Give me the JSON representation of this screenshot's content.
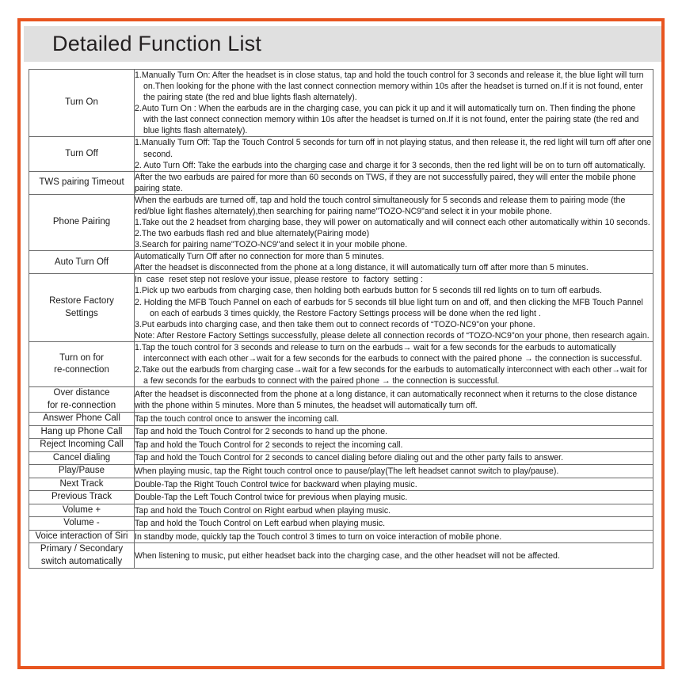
{
  "theme": {
    "frame_color": "#e8551f",
    "title_band_color": "#e0e0e0",
    "table_border_color": "#6b6b6b",
    "text_color": "#1a1a1a"
  },
  "header": {
    "title": "Detailed Function List"
  },
  "table": {
    "rows": [
      {
        "name": "Turn On",
        "lines": [
          {
            "style": "num",
            "text": "1.Manually Turn On: After the headset is in close status, tap and hold the touch control for 3 seconds and release it, the blue light will turn on.Then looking for the phone with the last connect connection memory within 10s after the headset is turned on.If it is not found, enter the pairing state (the red and blue lights flash alternately)."
          },
          {
            "style": "num",
            "text": "2.Auto Turn On : When the earbuds are in the charging case, you can pick it up and it will automatically turn on. Then finding the phone with the last connect connection memory within 10s after the headset is turned on.If it is not found, enter the pairing state (the red and blue lights flash alternately)."
          }
        ]
      },
      {
        "name": "Turn Off",
        "lines": [
          {
            "style": "num",
            "text": "1.Manually Turn Off: Tap the Touch Control 5 seconds for turn off in not playing status, and then release it, the red light will turn off after one second."
          },
          {
            "style": "num",
            "text": "2. Auto Turn Off: Take the earbuds into the charging case and charge it for 3 seconds, then the red light will be on to turn off automatically."
          }
        ]
      },
      {
        "name": "TWS pairing Timeout",
        "lines": [
          {
            "style": "plain",
            "text": "After the two earbuds are paired for more than 60 seconds on TWS, if they are not successfully paired, they will enter the mobile phone pairing state."
          }
        ]
      },
      {
        "name": "Phone Pairing",
        "lines": [
          {
            "style": "plain",
            "text": "When the earbuds are turned off, tap and hold the touch control simultaneously for 5 seconds and release them to pairing mode (the red/blue light flashes alternately),then searching for pairing name\"TOZO-NC9\"and select it in your mobile phone."
          },
          {
            "style": "num",
            "text": "1.Take out the 2 headset from charging base, they will power on automatically and will connect each other automatically within 10 seconds."
          },
          {
            "style": "num",
            "text": "2.The two earbuds flash red and blue alternately(Pairing mode)"
          },
          {
            "style": "num",
            "text": "3.Search for pairing name\"TOZO-NC9\"and select it in your mobile phone."
          }
        ]
      },
      {
        "name": "Auto Turn Off",
        "lines": [
          {
            "style": "plain",
            "text": "Automatically Turn Off after no connection for more than 5 minutes."
          },
          {
            "style": "plain",
            "text": "After the headset is disconnected from the phone at a long distance, it will automatically turn off after more than 5 minutes."
          }
        ]
      },
      {
        "name": "Restore Factory\nSettings",
        "lines": [
          {
            "style": "plain",
            "text": "In  case  reset step not reslove your issue, please restore  to  factory  setting :"
          },
          {
            "style": "num",
            "text": "1.Pick up two earbuds from charging case, then holding both earbuds button for 5 seconds till red lights on to turn off earbuds."
          },
          {
            "style": "sub",
            "text": "2. Holding the MFB Touch Pannel on each of earbuds for 5 seconds till blue light turn on and off, and then clicking the MFB Touch Pannel on each of earbuds 3 times quickly, the Restore Factory Settings process will be done when the red light ."
          },
          {
            "style": "num",
            "text": "3.Put earbuds into charging case, and then take them out to connect records of “TOZO-NC9”on your phone."
          },
          {
            "style": "note",
            "text": "Note: After Restore Factory Settings successfully, please delete all connection records of “TOZO-NC9”on your phone, then research again."
          }
        ]
      },
      {
        "name": "Turn on for\nre-connection",
        "lines": [
          {
            "style": "num",
            "text": "1.Tap the touch control for 3 seconds and release to turn on the earbuds→ wait for a few seconds for the earbuds to automatically interconnect with each other→wait for a few seconds for the earbuds to connect with the paired phone → the connection is successful."
          },
          {
            "style": "num",
            "text": "2.Take out the earbuds from charging case→wait for a few seconds for the earbuds to automatically interconnect with each other→wait for a few seconds for the earbuds to connect with the paired phone → the connection is successful."
          }
        ]
      },
      {
        "name": "Over distance\nfor re-connection",
        "lines": [
          {
            "style": "plain",
            "text": "After the headset is disconnected from the phone at a long distance, it can automatically reconnect when it returns to the close distance with the phone within 5 minutes. More than 5 minutes, the headset will automatically turn off."
          }
        ]
      },
      {
        "name": "Answer Phone Call",
        "lines": [
          {
            "style": "plain",
            "text": "Tap the touch control once to answer the incoming call."
          }
        ]
      },
      {
        "name": "Hang up Phone Call",
        "lines": [
          {
            "style": "plain",
            "text": "Tap and hold the Touch Control for 2 seconds to hand up the phone."
          }
        ]
      },
      {
        "name": "Reject Incoming Call",
        "lines": [
          {
            "style": "plain",
            "text": "Tap and hold the Touch Control for 2 seconds to reject the incoming call."
          }
        ]
      },
      {
        "name": "Cancel dialing",
        "lines": [
          {
            "style": "plain",
            "text": "Tap and hold the Touch Control for 2 seconds to cancel dialing before dialing out and the other party fails to answer."
          }
        ]
      },
      {
        "name": "Play/Pause",
        "lines": [
          {
            "style": "plain",
            "text": "When playing music, tap the Right touch control once to pause/play(The left headset cannot switch to play/pause)."
          }
        ]
      },
      {
        "name": "Next Track",
        "lines": [
          {
            "style": "plain",
            "text": "Double-Tap the Right Touch Control twice for backward when playing music."
          }
        ]
      },
      {
        "name": "Previous Track",
        "lines": [
          {
            "style": "plain",
            "text": "Double-Tap the Left Touch Control twice for previous when playing music."
          }
        ]
      },
      {
        "name": "Volume +",
        "lines": [
          {
            "style": "plain",
            "text": "Tap and hold the Touch Control on Right earbud when playing music."
          }
        ]
      },
      {
        "name": "Volume -",
        "lines": [
          {
            "style": "plain",
            "text": "Tap and hold the Touch Control on Left earbud when playing music."
          }
        ]
      },
      {
        "name": "Voice interaction of Siri",
        "lines": [
          {
            "style": "plain",
            "text": "In standby mode, quickly tap the Touch control 3 times to turn on voice interaction of mobile phone."
          }
        ]
      },
      {
        "name": "Primary / Secondary\nswitch automatically",
        "lines": [
          {
            "style": "plain",
            "text": "When listening to music, put either headset back into the charging case, and the other headset will not be affected."
          }
        ]
      }
    ]
  }
}
